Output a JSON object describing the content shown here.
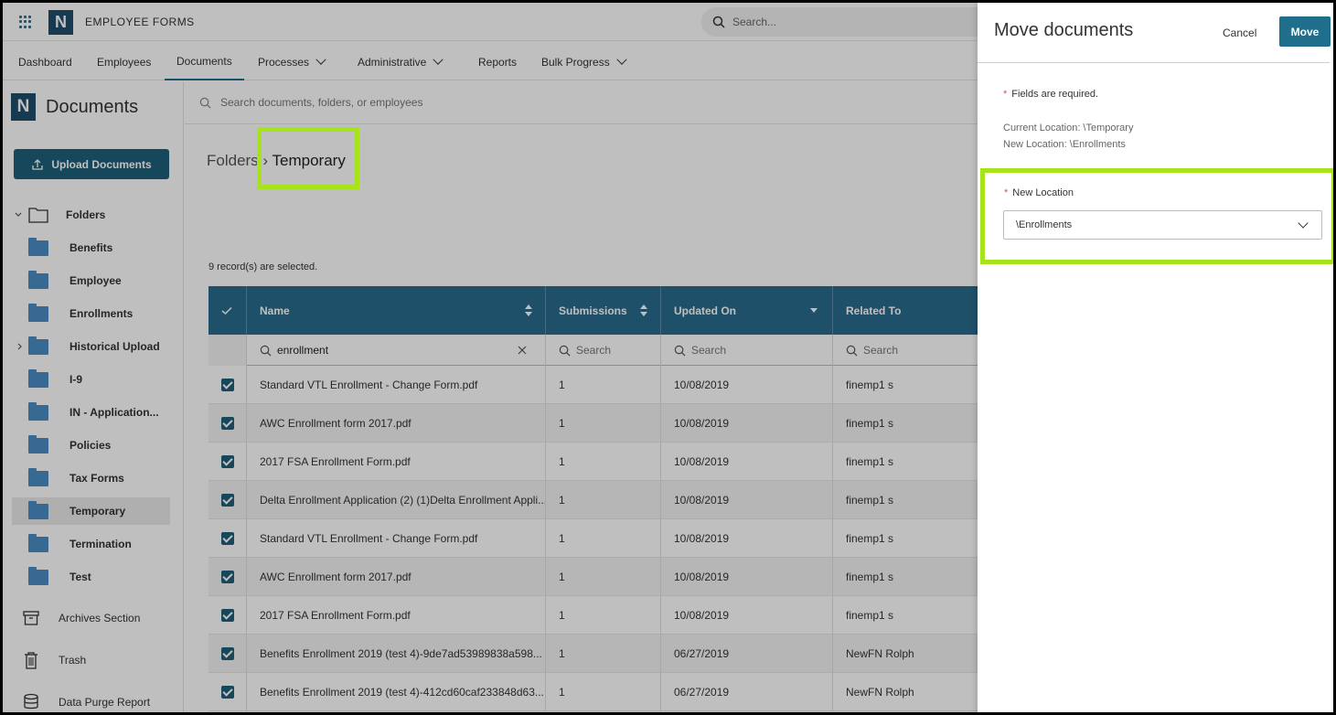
{
  "app": {
    "title": "EMPLOYEE FORMS",
    "logo_letter": "N",
    "search_placeholder": "Search..."
  },
  "nav": {
    "items": [
      {
        "label": "Dashboard",
        "dropdown": false
      },
      {
        "label": "Employees",
        "dropdown": false
      },
      {
        "label": "Documents",
        "dropdown": false,
        "active": true
      },
      {
        "label": "Processes",
        "dropdown": true
      },
      {
        "label": "Administrative",
        "dropdown": true
      },
      {
        "label": "Reports",
        "dropdown": false
      },
      {
        "label": "Bulk Progress",
        "dropdown": true
      }
    ]
  },
  "sidebar": {
    "logo_letter": "N",
    "title": "Documents",
    "upload_label": "Upload Documents",
    "folders_label": "Folders",
    "folders": [
      {
        "label": "Benefits"
      },
      {
        "label": "Employee"
      },
      {
        "label": "Enrollments"
      },
      {
        "label": "Historical Upload",
        "expandable": true
      },
      {
        "label": "I-9"
      },
      {
        "label": "IN - Application..."
      },
      {
        "label": "Policies"
      },
      {
        "label": "Tax Forms"
      },
      {
        "label": "Temporary",
        "selected": true
      },
      {
        "label": "Termination"
      },
      {
        "label": "Test"
      }
    ],
    "links": [
      {
        "label": "Archives Section",
        "icon": "archive-icon"
      },
      {
        "label": "Trash",
        "icon": "trash-icon"
      },
      {
        "label": "Data Purge Report",
        "icon": "database-icon"
      }
    ]
  },
  "main": {
    "search_placeholder": "Search documents, folders, or employees",
    "breadcrumb": {
      "root": "Folders",
      "separator": "›",
      "current": "Temporary"
    },
    "selected_text": "9 record(s) are selected.",
    "table": {
      "columns": [
        "Name",
        "Submissions",
        "Updated On",
        "Related To"
      ],
      "filters": {
        "name": "enrollment",
        "search_placeholder": "Search"
      },
      "rows": [
        {
          "name": "Standard VTL Enrollment - Change Form.pdf",
          "submissions": "1",
          "updated": "10/08/2019",
          "related": "finemp1 s"
        },
        {
          "name": "AWC Enrollment form 2017.pdf",
          "submissions": "1",
          "updated": "10/08/2019",
          "related": "finemp1 s"
        },
        {
          "name": "2017 FSA Enrollment Form.pdf",
          "submissions": "1",
          "updated": "10/08/2019",
          "related": "finemp1 s"
        },
        {
          "name": "Delta Enrollment Application (2) (1)Delta Enrollment Appli...",
          "submissions": "1",
          "updated": "10/08/2019",
          "related": "finemp1 s"
        },
        {
          "name": "Standard VTL Enrollment - Change Form.pdf",
          "submissions": "1",
          "updated": "10/08/2019",
          "related": "finemp1 s"
        },
        {
          "name": "AWC Enrollment form 2017.pdf",
          "submissions": "1",
          "updated": "10/08/2019",
          "related": "finemp1 s"
        },
        {
          "name": "2017 FSA Enrollment Form.pdf",
          "submissions": "1",
          "updated": "10/08/2019",
          "related": "finemp1 s"
        },
        {
          "name": "Benefits Enrollment 2019 (test 4)-9de7ad53989838a598...",
          "submissions": "1",
          "updated": "06/27/2019",
          "related": "NewFN Rolph"
        },
        {
          "name": "Benefits Enrollment 2019 (test 4)-412cd60caf233848d63...",
          "submissions": "1",
          "updated": "06/27/2019",
          "related": "NewFN Rolph"
        }
      ]
    }
  },
  "panel": {
    "title": "Move documents",
    "cancel_label": "Cancel",
    "move_label": "Move",
    "required_note": "Fields are required.",
    "current_location": "Current Location: \\Temporary",
    "new_location_info": "New Location: \\Enrollments",
    "field_label": "New Location",
    "field_value": "\\Enrollments"
  },
  "colors": {
    "primary": "#1f6e8c",
    "header": "#2a6b8e",
    "highlight": "#a6e31a",
    "required": "#d9534f"
  }
}
